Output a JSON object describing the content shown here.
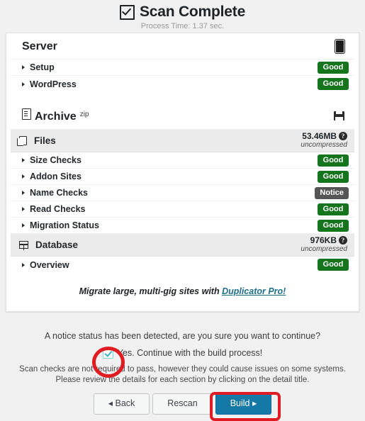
{
  "header": {
    "title": "Scan Complete",
    "subtitle": "Process Time: 1.37 sec.",
    "check_icon": "checked-box-icon"
  },
  "sections": [
    {
      "title": "Server",
      "superscript": "",
      "left_icon": "",
      "right_icon": "server-icon",
      "rows": [
        {
          "label": "Setup",
          "status": "Good",
          "status_type": "good"
        },
        {
          "label": "WordPress",
          "status": "Good",
          "status_type": "good"
        }
      ]
    },
    {
      "title": "Archive",
      "superscript": "zip",
      "left_icon": "document-icon",
      "right_icon": "floppy-save-icon",
      "groups": [
        {
          "label": "Files",
          "icon": "copy-pages-icon",
          "size": "53.46MB",
          "size_note": "uncompressed",
          "help_icon": "help-question-icon",
          "rows": [
            {
              "label": "Size Checks",
              "status": "Good",
              "status_type": "good"
            },
            {
              "label": "Addon Sites",
              "status": "Good",
              "status_type": "good"
            },
            {
              "label": "Name Checks",
              "status": "Notice",
              "status_type": "notice"
            },
            {
              "label": "Read Checks",
              "status": "Good",
              "status_type": "good"
            },
            {
              "label": "Migration Status",
              "status": "Good",
              "status_type": "good"
            }
          ]
        },
        {
          "label": "Database",
          "icon": "table-grid-icon",
          "size": "976KB",
          "size_note": "uncompressed",
          "help_icon": "help-question-icon",
          "rows": [
            {
              "label": "Overview",
              "status": "Good",
              "status_type": "good"
            }
          ]
        }
      ]
    }
  ],
  "promo": {
    "text_before": "Migrate large, multi-gig sites with ",
    "link_text": "Duplicator Pro!"
  },
  "footer": {
    "notice_question": "A notice status has been detected, are you sure you want to continue?",
    "confirm_label": "Yes. Continue with the build process!",
    "confirm_checked": true,
    "fineprint_line1": "Scan checks are not required to pass, however they could cause issues on some systems.",
    "fineprint_line2": "Please review the details for each section by clicking on the detail title.",
    "buttons": {
      "back": "◂ Back",
      "rescan": "Rescan",
      "build": "Build ▸"
    }
  },
  "colors": {
    "good_badge": "#14751c",
    "notice_badge": "#555555",
    "primary_button": "#1579a8",
    "annotation_red": "#e01b22",
    "checkbox_teal": "#3ab0c6",
    "link": "#1f6f8b"
  }
}
